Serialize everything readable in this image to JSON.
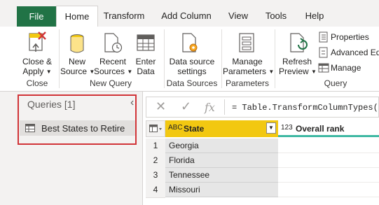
{
  "tabs": [
    {
      "label": "File"
    },
    {
      "label": "Home"
    },
    {
      "label": "Transform"
    },
    {
      "label": "Add Column"
    },
    {
      "label": "View"
    },
    {
      "label": "Tools"
    },
    {
      "label": "Help"
    }
  ],
  "ribbon": {
    "close_apply": {
      "line1": "Close &",
      "line2": "Apply"
    },
    "new_source": {
      "line1": "New",
      "line2": "Source"
    },
    "recent_sources": {
      "line1": "Recent",
      "line2": "Sources"
    },
    "enter_data": {
      "line1": "Enter",
      "line2": "Data"
    },
    "data_source_settings": {
      "line1": "Data source",
      "line2": "settings"
    },
    "manage_parameters": {
      "line1": "Manage",
      "line2": "Parameters"
    },
    "refresh_preview": {
      "line1": "Refresh",
      "line2": "Preview"
    },
    "properties": "Properties",
    "advanced_editor": "Advanced Editor",
    "manage": "Manage",
    "groups": {
      "close": "Close",
      "new_query": "New Query",
      "data_sources": "Data Sources",
      "parameters": "Parameters",
      "query": "Query"
    }
  },
  "queries": {
    "header": "Queries [1]",
    "items": [
      {
        "label": "Best States to Retire"
      }
    ]
  },
  "formula_bar": {
    "fx": "fx",
    "formula": "= Table.TransformColumnTypes("
  },
  "table": {
    "columns": [
      {
        "type_icon": "ABC",
        "name": "State"
      },
      {
        "type_icon": "123",
        "name": "Overall rank"
      }
    ],
    "rows": [
      {
        "num": "1",
        "state": "Georgia"
      },
      {
        "num": "2",
        "state": "Florida"
      },
      {
        "num": "3",
        "state": "Tennessee"
      },
      {
        "num": "4",
        "state": "Missouri"
      }
    ]
  },
  "colors": {
    "file_tab": "#217346",
    "state_header": "#f2c811",
    "highlight_box": "#d13438",
    "rank_underline": "#3fb8a3"
  }
}
